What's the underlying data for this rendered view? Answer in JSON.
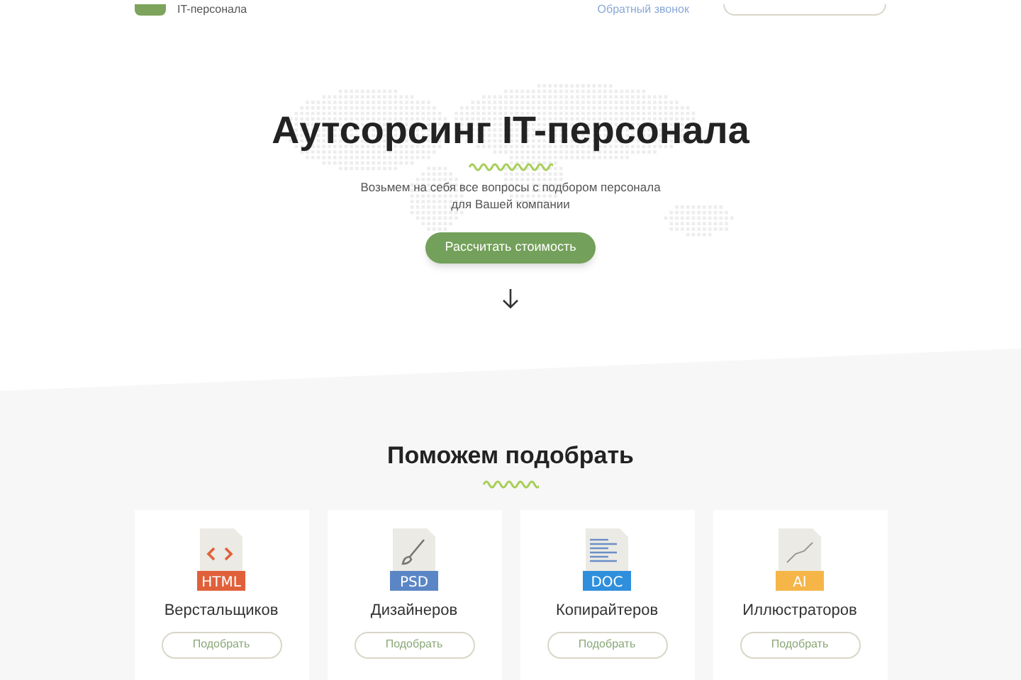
{
  "header": {
    "logo_text": "IT-персонала",
    "callback_link": "Обратный звонок"
  },
  "hero": {
    "title": "Аутсорсинг IT-персонала",
    "subtitle": "Возьмем на себя все вопросы с подбором персонала",
    "subtitle_line_2": "для Вашей компании",
    "button": "Рассчитать стоимость"
  },
  "help_section": {
    "title": "Поможем подобрать",
    "cards": [
      {
        "kind": "code",
        "badge": "HTML",
        "color": "#e0603a",
        "label": "Верстальщиков",
        "button": "Подобрать"
      },
      {
        "kind": "brush",
        "badge": "PSD",
        "color": "#5b86c5",
        "label": "Дизайнеров",
        "button": "Подобрать"
      },
      {
        "kind": "text",
        "badge": "DOC",
        "color": "#2f8fdc",
        "label": "Копирайтеров",
        "button": "Подобрать"
      },
      {
        "kind": "vector",
        "badge": "AI",
        "color": "#f5b547",
        "label": "Иллюстраторов",
        "button": "Подобрать"
      }
    ]
  }
}
